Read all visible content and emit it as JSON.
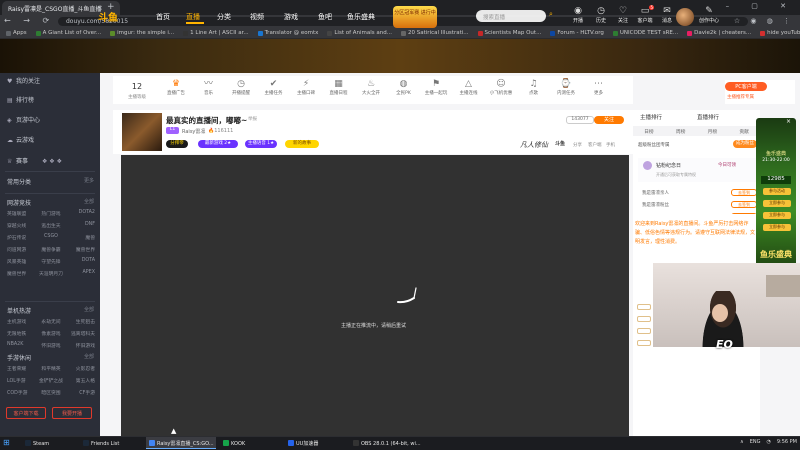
{
  "browser": {
    "tab_title": "Raisy雷凛是_CSGO直播_斗鱼直播",
    "tab_close": "×",
    "new_tab": "+",
    "window_controls": "–  ▢  ✕",
    "nav_buttons": "←  →  ⟳",
    "url": "douyu.com/5820015",
    "profile_icons": "☆ ◉ ◍ ⋮",
    "bookmarks": [
      {
        "label": "Apps",
        "color": "#5f6368"
      },
      {
        "label": "A Giant List of Over...",
        "color": "#2e7d32"
      },
      {
        "label": "imgur: the simple i...",
        "color": "#5b8c2a"
      },
      {
        "label": "1 Line Art | ASCII ar...",
        "color": "#333333"
      },
      {
        "label": "Translator @ eomtx",
        "color": "#1976d2"
      },
      {
        "label": "List of Animals and...",
        "color": "#444444"
      },
      {
        "label": "20 Satirical Illustrati...",
        "color": "#666666"
      },
      {
        "label": "Scientists Map Out...",
        "color": "#c62828"
      },
      {
        "label": "Forum - HLTV.org",
        "color": "#0d47a1"
      },
      {
        "label": "UNICODE TEST sRE...",
        "color": "#2e7d32"
      },
      {
        "label": "Davie2k | cheaters...",
        "color": "#e91e63"
      },
      {
        "label": "hide youTube bar",
        "color": "#d32f2f"
      }
    ]
  },
  "site": {
    "logo": "斗鱼",
    "nav": [
      "首页",
      "直播",
      "分类",
      "视频",
      "游戏",
      "鱼吧",
      "鱼乐盛典"
    ],
    "promo": "分区冠军赛\n进行中",
    "search_placeholder": "搜索直播",
    "search_icon_glyph": "⌕",
    "header_icons": [
      {
        "label": "开播",
        "glyph": "◉",
        "badge": ""
      },
      {
        "label": "历史",
        "glyph": "◷",
        "badge": ""
      },
      {
        "label": "关注",
        "glyph": "♡",
        "badge": ""
      },
      {
        "label": "客户端",
        "glyph": "▭",
        "badge": "5"
      },
      {
        "label": "消息",
        "glyph": "✉",
        "badge": ""
      },
      {
        "label": "创作中心",
        "glyph": "✎",
        "badge": ""
      }
    ]
  },
  "sidebar": {
    "main_items": [
      {
        "icon": "♥",
        "label": "我的关注"
      },
      {
        "icon": "▤",
        "label": "排行榜"
      },
      {
        "icon": "◈",
        "label": "页游中心"
      },
      {
        "icon": "☁",
        "label": "云游戏"
      }
    ],
    "events_label": "赛事",
    "common_label": "常用分类",
    "common_more": "更多",
    "sections": [
      {
        "title": "网游竞技",
        "more": "全部",
        "items": [
          "英雄联盟",
          "热门游戏",
          "DOTA2",
          "穿越火线",
          "逃出生天",
          "DNF",
          "炉石传说",
          "CSGO",
          "魔兽",
          "问道网游",
          "魔兽争霸",
          "魔兽世界",
          "风暴英雄",
          "守望先锋",
          "DOTA",
          "魔兽世界",
          "天涯明月刀",
          "APEX"
        ]
      },
      {
        "title": "单机热游",
        "more": "全部",
        "items": [
          "主机游戏",
          "永劫无间",
          "生死狙击",
          "无限地铁",
          "像素游戏",
          "逃离塔科夫",
          "NBA2K",
          "怀旧游戏",
          "怀旧游戏"
        ]
      },
      {
        "title": "手游休闲",
        "more": "全部",
        "items": [
          "王者荣耀",
          "和平精英",
          "火影忍者",
          "LOL手游",
          "金铲铲之战",
          "第五人格",
          "COD手游",
          "暗区突围",
          "CF手游"
        ]
      }
    ],
    "btn_client": "客户端下载",
    "btn_broadcast": "我要开播"
  },
  "quickbar": {
    "count": "12",
    "count_label": "主播等级",
    "items": [
      {
        "glyph": "♛",
        "label": "直播广告",
        "orange": true
      },
      {
        "glyph": "〰",
        "label": "音乐",
        "orange": false
      },
      {
        "glyph": "◷",
        "label": "开播提醒",
        "orange": false
      },
      {
        "glyph": "✔",
        "label": "主播任务",
        "orange": false
      },
      {
        "glyph": "⚡",
        "label": "主播口碑",
        "orange": false
      },
      {
        "glyph": "▦",
        "label": "直播日程",
        "orange": false
      },
      {
        "glyph": "♨",
        "label": "大火全开",
        "orange": false
      },
      {
        "glyph": "◍",
        "label": "全民PK",
        "orange": false
      },
      {
        "glyph": "⚑",
        "label": "主播一起玩",
        "orange": false
      },
      {
        "glyph": "△",
        "label": "主播连线",
        "orange": false
      },
      {
        "glyph": "☺",
        "label": "小飞机优惠",
        "orange": false
      },
      {
        "glyph": "♫",
        "label": "点歌",
        "orange": false
      },
      {
        "glyph": "⌚",
        "label": "内测任务",
        "orange": false
      },
      {
        "glyph": "⋯",
        "label": "更多",
        "orange": false
      }
    ],
    "pc_client": "PC客户端",
    "pc_note": "主播推荐专属"
  },
  "room": {
    "title": "最真实的直播间，嘟嘟~",
    "report": "举报",
    "level": "L1",
    "streamer": "Raisy雷凛",
    "hot": "116111",
    "follow_badge": "分拜帝",
    "tags": [
      "最新游戏 2★",
      "主播语音 1★",
      "新的故事"
    ],
    "watermark": "凡人修仙",
    "sponsor": "斗鱼",
    "viewers": "143077",
    "follow": "关注",
    "tools": [
      "分享",
      "客户端",
      "手机"
    ]
  },
  "player": {
    "message": "主播正在推流中，请稍后重试"
  },
  "rank": {
    "title": "主播排行",
    "title2": "直播排行",
    "tabs": [
      "日榜",
      "周榜",
      "月榜",
      "贡献"
    ],
    "label": "超级粉丝团专属",
    "button": "成为粉丝",
    "fan_name": "钻粉纪念日",
    "fan_date": "今日可领",
    "fan_sub": "开通后可获取专属特权",
    "items": [
      {
        "label": "我是雷凛亲人",
        "btn": "去签到"
      },
      {
        "label": "我是雷凛粉丝",
        "btn": "去签到"
      },
      {
        "label": "加入粉丝团",
        "btn": "去加入"
      }
    ]
  },
  "chat": {
    "notice": "欢迎来到Raisy雷凛的直播间。斗鱼严厉打击网络诈骗、低俗色情等违规行为。请遵守互联网法律法规，文明发言，理性消费。"
  },
  "event": {
    "title": "鱼乐盛典",
    "time": "21:30-22:00",
    "number": "12985",
    "btns": [
      "参与活动",
      "立即参与",
      "立即参与",
      "立即参与"
    ],
    "close": "×",
    "bottom": "鱼乐盛典"
  },
  "webcam": {
    "watermark": "EO"
  },
  "taskbar": {
    "start_glyph": "⊞",
    "items": [
      {
        "label": "Steam",
        "color": "#1b2838",
        "active": false
      },
      {
        "label": "Friends List",
        "color": "#1b2838",
        "active": false
      },
      {
        "label": "Raisy雷凛直播_CS:GO...",
        "color": "#4285f4",
        "active": true
      },
      {
        "label": "KOOK",
        "color": "#16a34a",
        "active": false
      },
      {
        "label": "UU加速器",
        "color": "#2563eb",
        "active": false
      },
      {
        "label": "OBS 28.0.1 (64-bit, wi...",
        "color": "#333333",
        "active": false
      }
    ],
    "tray": [
      "∧",
      "ENG",
      "◔",
      "9:56 PM"
    ]
  }
}
